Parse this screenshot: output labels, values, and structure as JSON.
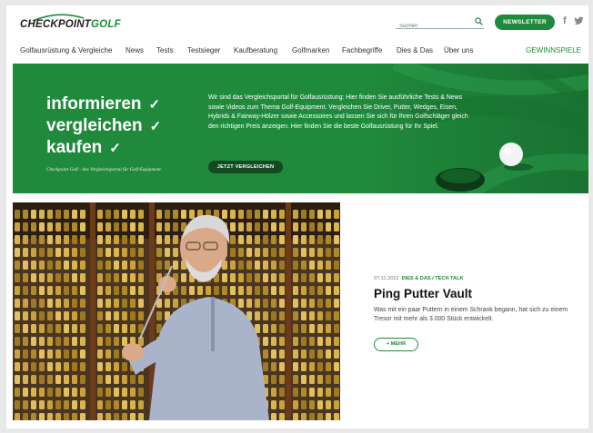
{
  "header": {
    "logo_part1": "CHECKPOINT",
    "logo_part2": "GOLF",
    "search_placeholder": "Suchen",
    "newsletter_label": "NEWSLETTER",
    "social": {
      "facebook": "f"
    }
  },
  "nav": {
    "items": [
      "Golfausrüstung & Vergleiche",
      "News",
      "Tests",
      "Testsieger",
      "Kaufberatung",
      "Golfmarken",
      "Fachbegriffe",
      "Dies & Das",
      "Über uns"
    ],
    "right_link": "GEWINNSPIELE"
  },
  "hero": {
    "words": [
      "informieren",
      "vergleichen",
      "kaufen"
    ],
    "check": "✓",
    "tagline": "Checkpoint Golf - das Vergleichsportal für Golf-Equipment.",
    "text": "Wir sind das Vergleichsportal für Golfausrüstung: Hier finden Sie ausführliche Tests & News sowie Videos zum Thema Golf-Equipment. Vergleichen Sie Driver, Putter, Wedges, Eisen, Hybrids & Fairway-Hölzer sowie Accessoires und lassen Sie sich für Ihren Golfschläger gleich den richtigen Preis anzeigen. Hier finden Sie die beste Golfausrüstung für Ihr Spiel.",
    "button_label": "JETZT VERGLEICHEN"
  },
  "article": {
    "date": "07.11.2022",
    "category": "DIES & DAS / TECH TALK",
    "title": "Ping Putter Vault",
    "teaser": "Was mit ein paar Puttern in einem Schrank begann, hat sich zu einem Tresor mit mehr als 3.000 Stück entwickelt.",
    "more_label": "+ MEHR"
  },
  "colors": {
    "brand_green": "#1f8a3c",
    "dark_green": "#134a22"
  },
  "icons": [
    "search-icon",
    "facebook-icon",
    "twitter-icon",
    "check-icon",
    "golf-ball-icon"
  ]
}
